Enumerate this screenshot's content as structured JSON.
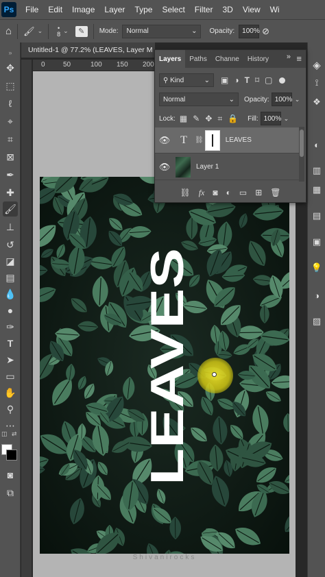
{
  "menu": {
    "logo": "Ps",
    "items": [
      "File",
      "Edit",
      "Image",
      "Layer",
      "Type",
      "Select",
      "Filter",
      "3D",
      "View",
      "Wi"
    ]
  },
  "options": {
    "brush_size": "8",
    "mode_label": "Mode:",
    "mode_value": "Normal",
    "opacity_label": "Opacity:",
    "opacity_value": "100%"
  },
  "document": {
    "tab_title": "Untitled-1 @ 77.2% (LEAVES, Layer M",
    "ruler_labels": [
      "0",
      "50",
      "100",
      "150",
      "200"
    ],
    "canvas_text": "LEAVES",
    "watermark": "Shivanirocks"
  },
  "layers_panel": {
    "tabs": [
      "Layers",
      "Paths",
      "Channe",
      "History"
    ],
    "active_tab": "Layers",
    "filter_kind": "Kind",
    "blend_mode": "Normal",
    "opacity_label": "Opacity:",
    "opacity_value": "100%",
    "lock_label": "Lock:",
    "fill_label": "Fill:",
    "fill_value": "100%",
    "layers": [
      {
        "name": "LEAVES",
        "type": "text",
        "selected": true
      },
      {
        "name": "Layer 1",
        "type": "image",
        "selected": false
      }
    ]
  },
  "colors": {
    "accent": "#31a8ff",
    "panel": "#535353",
    "foliage_dark": "#0e1a14",
    "leaf": "#3f6b52",
    "highlight": "#e6dc28"
  }
}
